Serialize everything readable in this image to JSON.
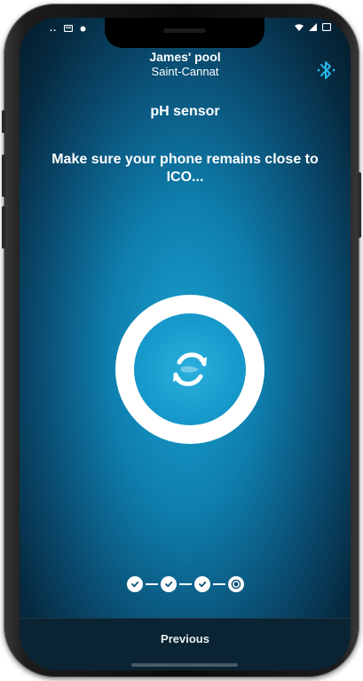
{
  "status_bar": {
    "left_text": "",
    "right_text": ""
  },
  "header": {
    "pool_name": "James' pool",
    "location": "Saint-Cannat",
    "bluetooth_icon": "bluetooth-icon"
  },
  "main": {
    "title": "pH sensor",
    "instruction": "Make sure your phone remains close to ICO...",
    "sync_icon": "sync-icon"
  },
  "stepper": {
    "steps": [
      {
        "state": "completed"
      },
      {
        "state": "completed"
      },
      {
        "state": "completed"
      },
      {
        "state": "current"
      }
    ]
  },
  "footer": {
    "previous_label": "Previous"
  },
  "colors": {
    "accent": "#1597c9",
    "background_dark": "#062a40",
    "footer_bg": "#0a2433",
    "bluetooth": "#2ab4e8"
  }
}
